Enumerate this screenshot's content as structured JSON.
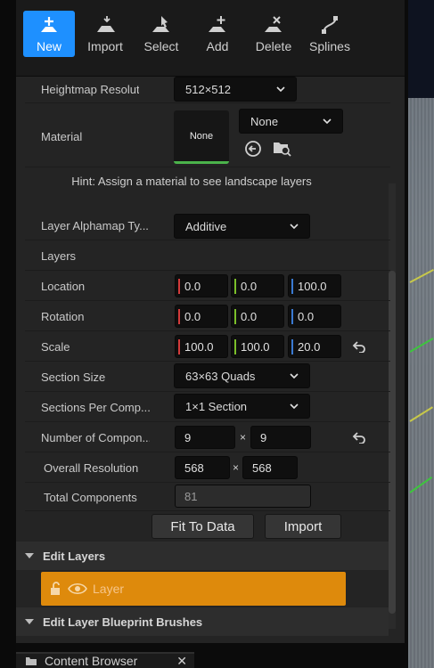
{
  "toolbar": {
    "items": [
      {
        "label": "New",
        "icon": "new-icon",
        "active": true
      },
      {
        "label": "Import",
        "icon": "import-icon",
        "active": false
      },
      {
        "label": "Select",
        "icon": "select-icon",
        "active": false
      },
      {
        "label": "Add",
        "icon": "add-icon",
        "active": false
      },
      {
        "label": "Delete",
        "icon": "delete-icon",
        "active": false
      },
      {
        "label": "Splines",
        "icon": "splines-icon",
        "active": false
      }
    ]
  },
  "settings": {
    "heightmap_resolution": {
      "label": "Heightmap Resolution",
      "value": "512×512"
    },
    "material": {
      "label": "Material",
      "thumb_text": "None",
      "value": "None"
    },
    "hint": "Hint: Assign a material to see landscape layers",
    "layer_alphamap_type": {
      "label": "Layer Alphamap Ty...",
      "value": "Additive"
    },
    "layers": {
      "label": "Layers"
    },
    "location": {
      "label": "Location",
      "x": "0.0",
      "y": "0.0",
      "z": "100.0"
    },
    "rotation": {
      "label": "Rotation",
      "x": "0.0",
      "y": "0.0",
      "z": "0.0"
    },
    "scale": {
      "label": "Scale",
      "x": "100.0",
      "y": "100.0",
      "z": "20.0"
    },
    "section_size": {
      "label": "Section Size",
      "value": "63×63 Quads"
    },
    "sections_per_component": {
      "label": "Sections Per Comp...",
      "value": "1×1 Section"
    },
    "number_of_components": {
      "label": "Number of Compon...",
      "x": "9",
      "sep": "×",
      "y": "9"
    },
    "overall_resolution": {
      "label": "Overall Resolution",
      "x": "568",
      "sep": "×",
      "y": "568"
    },
    "total_components": {
      "label": "Total Components",
      "value": "81"
    }
  },
  "buttons": {
    "fit_to_data": "Fit To Data",
    "import": "Import"
  },
  "edit_layers": {
    "header": "Edit Layers",
    "layer_name": "Layer"
  },
  "blueprint_brushes": {
    "header": "Edit Layer Blueprint Brushes"
  },
  "bottom_tab": {
    "label": "Content Browser"
  },
  "colors": {
    "accent": "#1e90ff",
    "layer_highlight": "#de8a0c",
    "axis_x": "#d23a3a",
    "axis_y": "#7bbf2a",
    "axis_z": "#3a7ad2"
  }
}
